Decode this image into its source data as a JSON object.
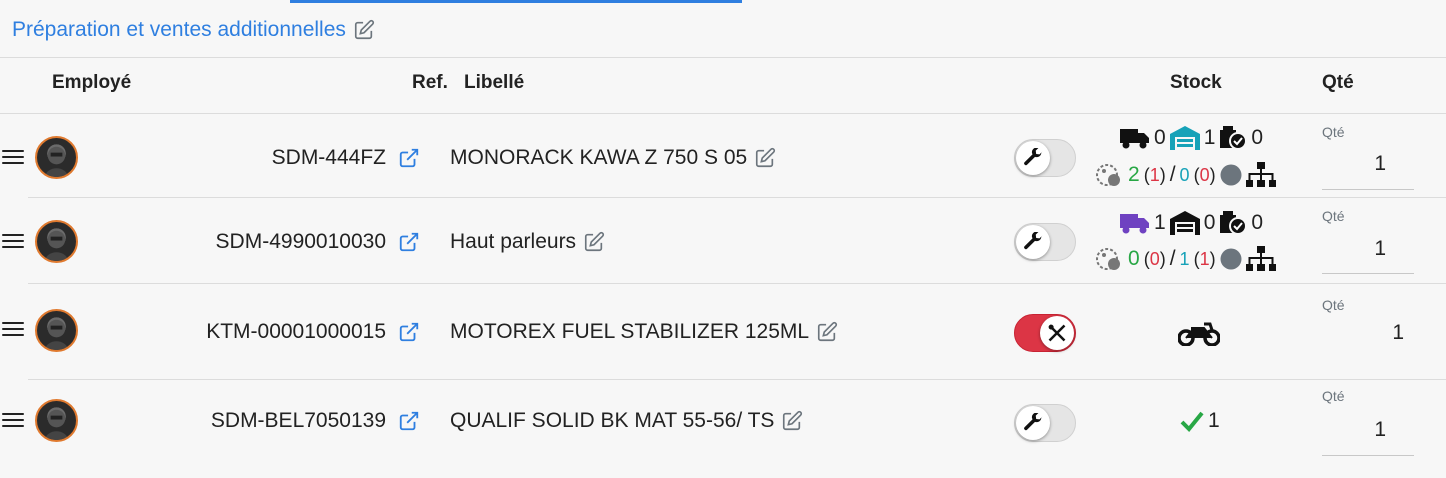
{
  "section": {
    "title": "Préparation et ventes additionnelles"
  },
  "table": {
    "headers": {
      "employee": "Employé",
      "ref": "Ref.",
      "label": "Libellé",
      "stock": "Stock",
      "qty": "Qté"
    },
    "rows": [
      {
        "ref": "SDM-444FZ",
        "label": "MONORACK KAWA Z 750 S 05",
        "toggle_on": false,
        "stock": {
          "delivery": "0",
          "warehouse": "1",
          "reserved": "0",
          "tagged": "2",
          "tagged_paren": "1",
          "other": "0",
          "other_paren": "0"
        },
        "qty_label": "Qté",
        "qty": "1"
      },
      {
        "ref": "SDM-4990010030",
        "label": "Haut parleurs",
        "toggle_on": false,
        "stock": {
          "delivery": "1",
          "warehouse": "0",
          "reserved": "0",
          "tagged": "0",
          "tagged_paren": "0",
          "other": "1",
          "other_paren": "1"
        },
        "qty_label": "Qté",
        "qty": "1"
      },
      {
        "ref": "KTM-00001000015",
        "label": "MOTOREX FUEL STABILIZER 125ML",
        "toggle_on": true,
        "qty_label": "Qté",
        "qty": "1"
      },
      {
        "ref": "SDM-BEL7050139",
        "label": "QUALIF SOLID BK MAT 55-56/ TS",
        "toggle_on": false,
        "stock_check": "1",
        "qty_label": "Qté",
        "qty": "1"
      }
    ]
  },
  "colors": {
    "accent": "#2f7fe0",
    "toggle_on": "#dc3545",
    "ok_green": "#28a745",
    "delivery_purple": "#6f42c1",
    "warehouse_teal": "#17a2b8"
  },
  "icons": [
    "drag-handle-icon",
    "avatar",
    "external-link-icon",
    "edit-icon",
    "wrench-icon",
    "truck-icon",
    "warehouse-icon",
    "reserved-box-icon",
    "tag-icon",
    "status-dot-icon",
    "hierarchy-icon",
    "motorcycle-icon",
    "check-icon"
  ]
}
